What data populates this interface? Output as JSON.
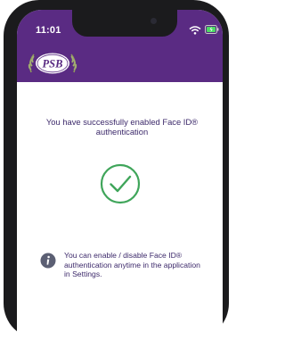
{
  "status_bar": {
    "time": "11:01"
  },
  "brand": {
    "logo_text": "PSB",
    "color": "#5a2b83"
  },
  "main": {
    "message": "You have successfully enabled Face ID® authentication",
    "success_icon": "check-circle-icon",
    "success_color": "#3fa55a",
    "info_icon": "info-icon",
    "info_text": "You can enable / disable Face ID® authentication anytime in the application in Settings."
  }
}
